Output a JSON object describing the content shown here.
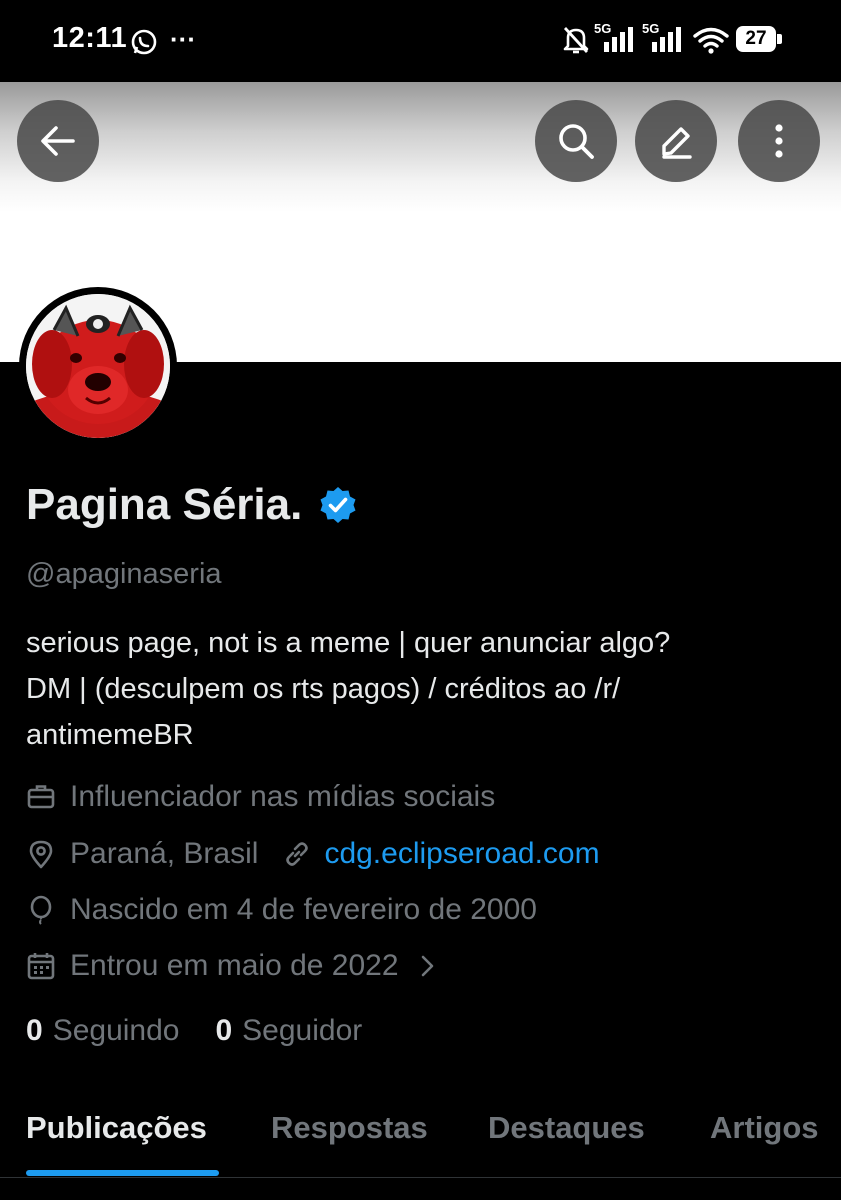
{
  "status_bar": {
    "time": "12:11",
    "more_dots": "···",
    "net1": "5G",
    "net2": "5G",
    "battery": "27",
    "icons": [
      "whatsapp-icon",
      "mute-bell-icon",
      "signal-icon",
      "wifi-icon",
      "battery-icon"
    ]
  },
  "header": {
    "icons": [
      "back-arrow-icon",
      "search-icon",
      "edit-icon",
      "more-vertical-icon"
    ]
  },
  "profile": {
    "name": "Pagina Séria.",
    "handle": "@apaginaseria",
    "bio_lines": [
      "serious page, not is a meme | quer anunciar algo?",
      "DM | (desculpem os rts pagos) / créditos ao /r/",
      "antimemeBR"
    ],
    "category": "Influenciador nas mídias sociais",
    "location": "Paraná, Brasil",
    "website": "cdg.eclipseroad.com",
    "birth": "Nascido em 4 de fevereiro de 2000",
    "joined": "Entrou em maio de 2022",
    "following_count": "0",
    "following_label": "Seguindo",
    "followers_count": "0",
    "followers_label": "Seguidor"
  },
  "tabs": [
    {
      "label": "Publicações",
      "active": true
    },
    {
      "label": "Respostas",
      "active": false
    },
    {
      "label": "Destaques",
      "active": false
    },
    {
      "label": "Artigos",
      "active": false
    }
  ],
  "colors": {
    "accent": "#1d9bf0",
    "text": "#e7e9ea",
    "muted": "#71767b",
    "background": "#000000"
  }
}
